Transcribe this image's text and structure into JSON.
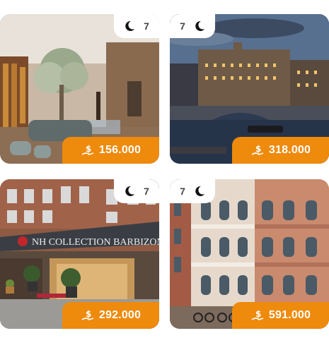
{
  "cards": [
    {
      "nights": "7",
      "price": "156.000",
      "scene": "hotel-lobby"
    },
    {
      "nights": "7",
      "price": "318.000",
      "scene": "canal-night"
    },
    {
      "nights": "7",
      "price": "292.000",
      "scene": "nh-collection-hotel",
      "sign_text": "NH COLLECTION BARBIZON PA"
    },
    {
      "nights": "7",
      "price": "591.000",
      "scene": "brick-townhouses"
    }
  ],
  "colors": {
    "accent": "#ee8a0c",
    "badge_bg": "#ffffff",
    "badge_text": "#444444"
  },
  "icons": {
    "nights": "moon-icon",
    "price": "currency-hand-icon"
  }
}
